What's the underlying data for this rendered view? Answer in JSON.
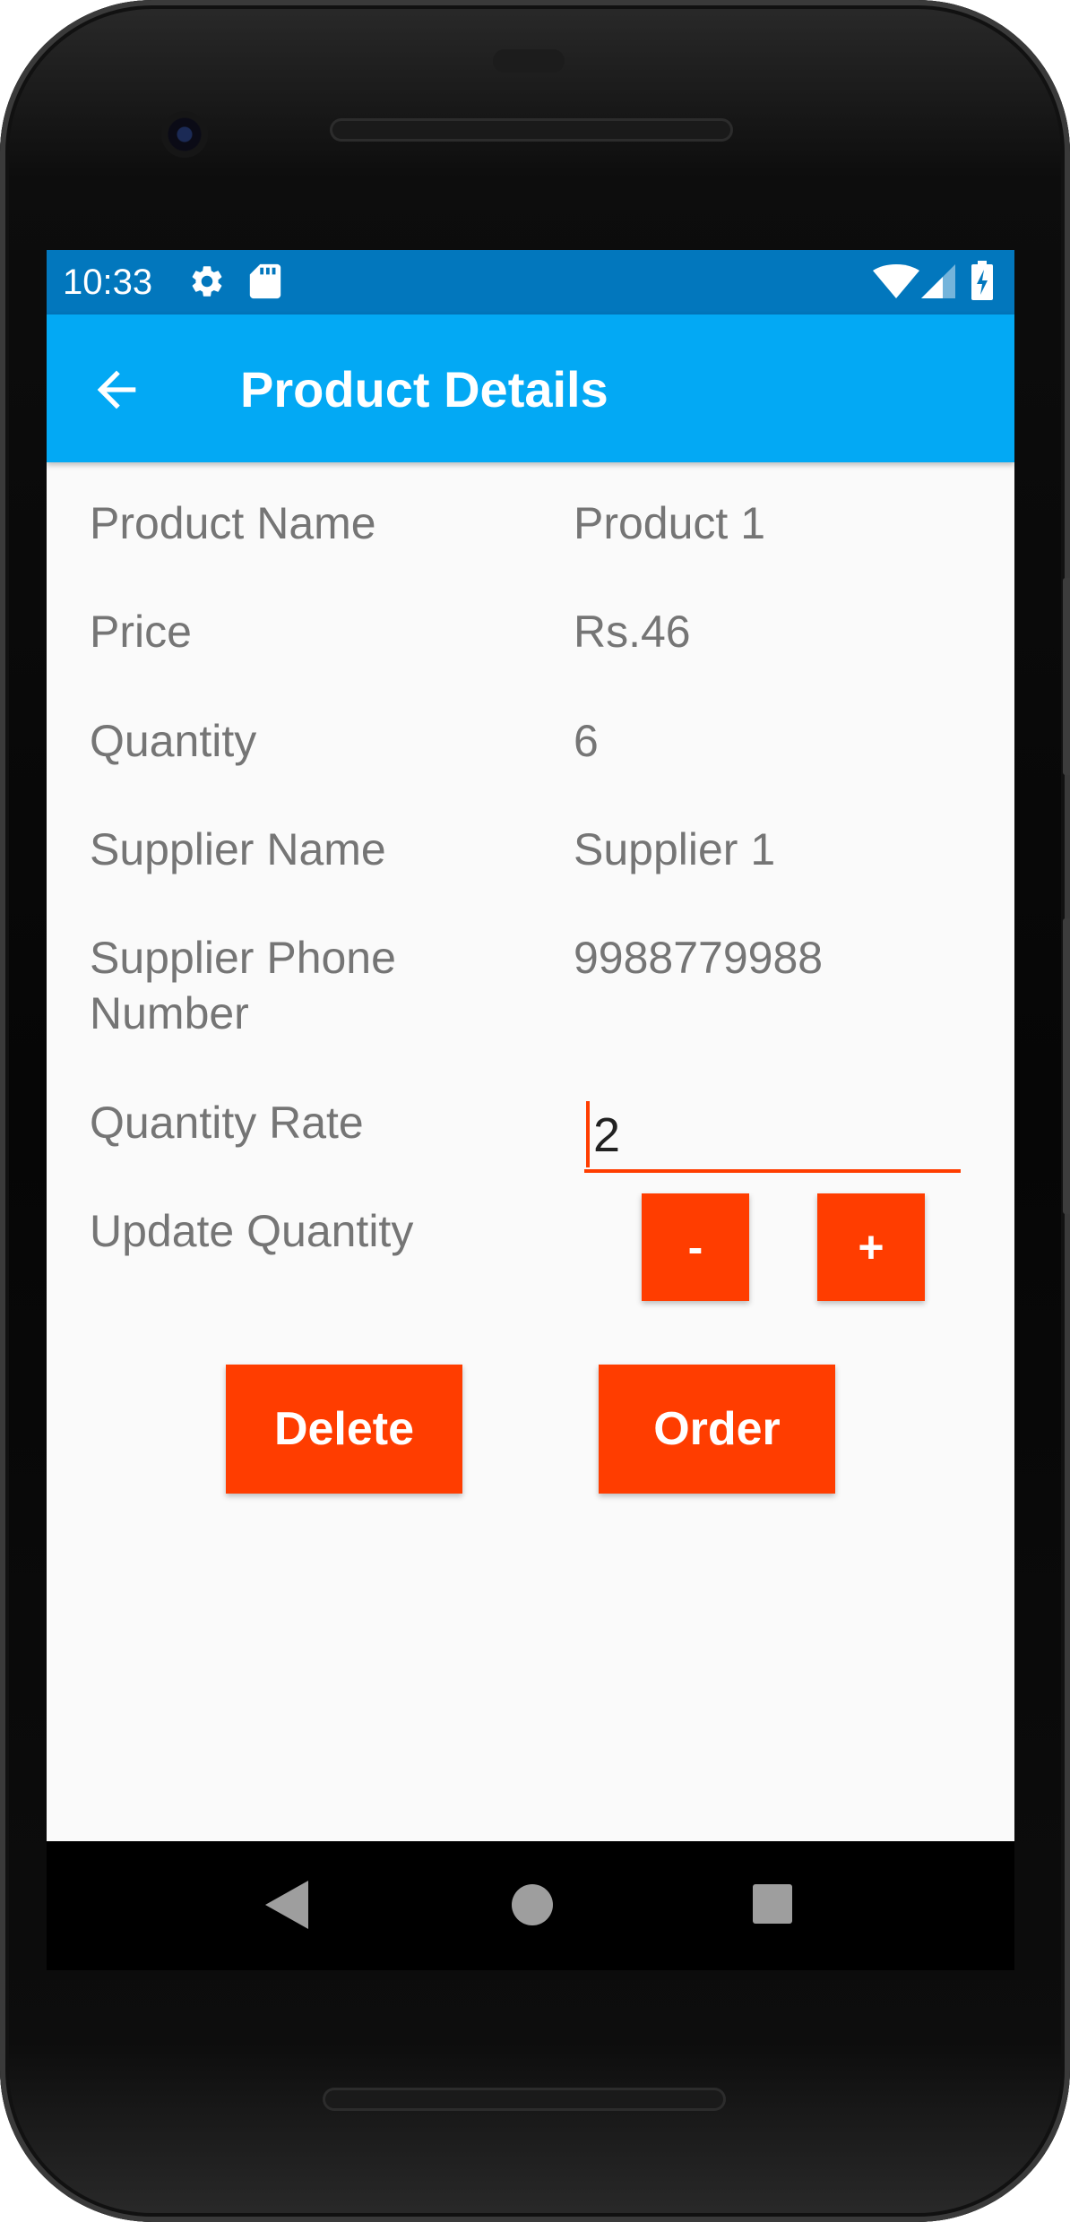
{
  "status_bar": {
    "time": "10:33",
    "left_icons": [
      "gear-icon",
      "sd-card-icon"
    ],
    "right_icons": [
      "wifi-icon",
      "signal-icon",
      "battery-charging-icon"
    ]
  },
  "app_bar": {
    "back_icon": "arrow-left-icon",
    "title": "Product Details"
  },
  "details": {
    "rows": [
      {
        "label": "Product Name",
        "value": "Product 1"
      },
      {
        "label": "Price",
        "value": "Rs.46"
      },
      {
        "label": "Quantity",
        "value": "6"
      },
      {
        "label": "Supplier Name",
        "value": "Supplier 1"
      },
      {
        "label": "Supplier Phone Number",
        "value": "9988779988"
      }
    ]
  },
  "quantity_rate": {
    "label": "Quantity Rate",
    "value": "2"
  },
  "update_quantity": {
    "label": "Update Quantity",
    "decrement_label": "-",
    "increment_label": "+"
  },
  "actions": {
    "delete_label": "Delete",
    "order_label": "Order"
  },
  "nav_bar": {
    "icons": [
      "back-triangle-icon",
      "home-circle-icon",
      "recents-square-icon"
    ]
  },
  "colors": {
    "status_bar": "#0277bd",
    "app_bar": "#03a9f4",
    "accent": "#ff3d00",
    "background": "#fafafa",
    "text_secondary": "#757575"
  }
}
